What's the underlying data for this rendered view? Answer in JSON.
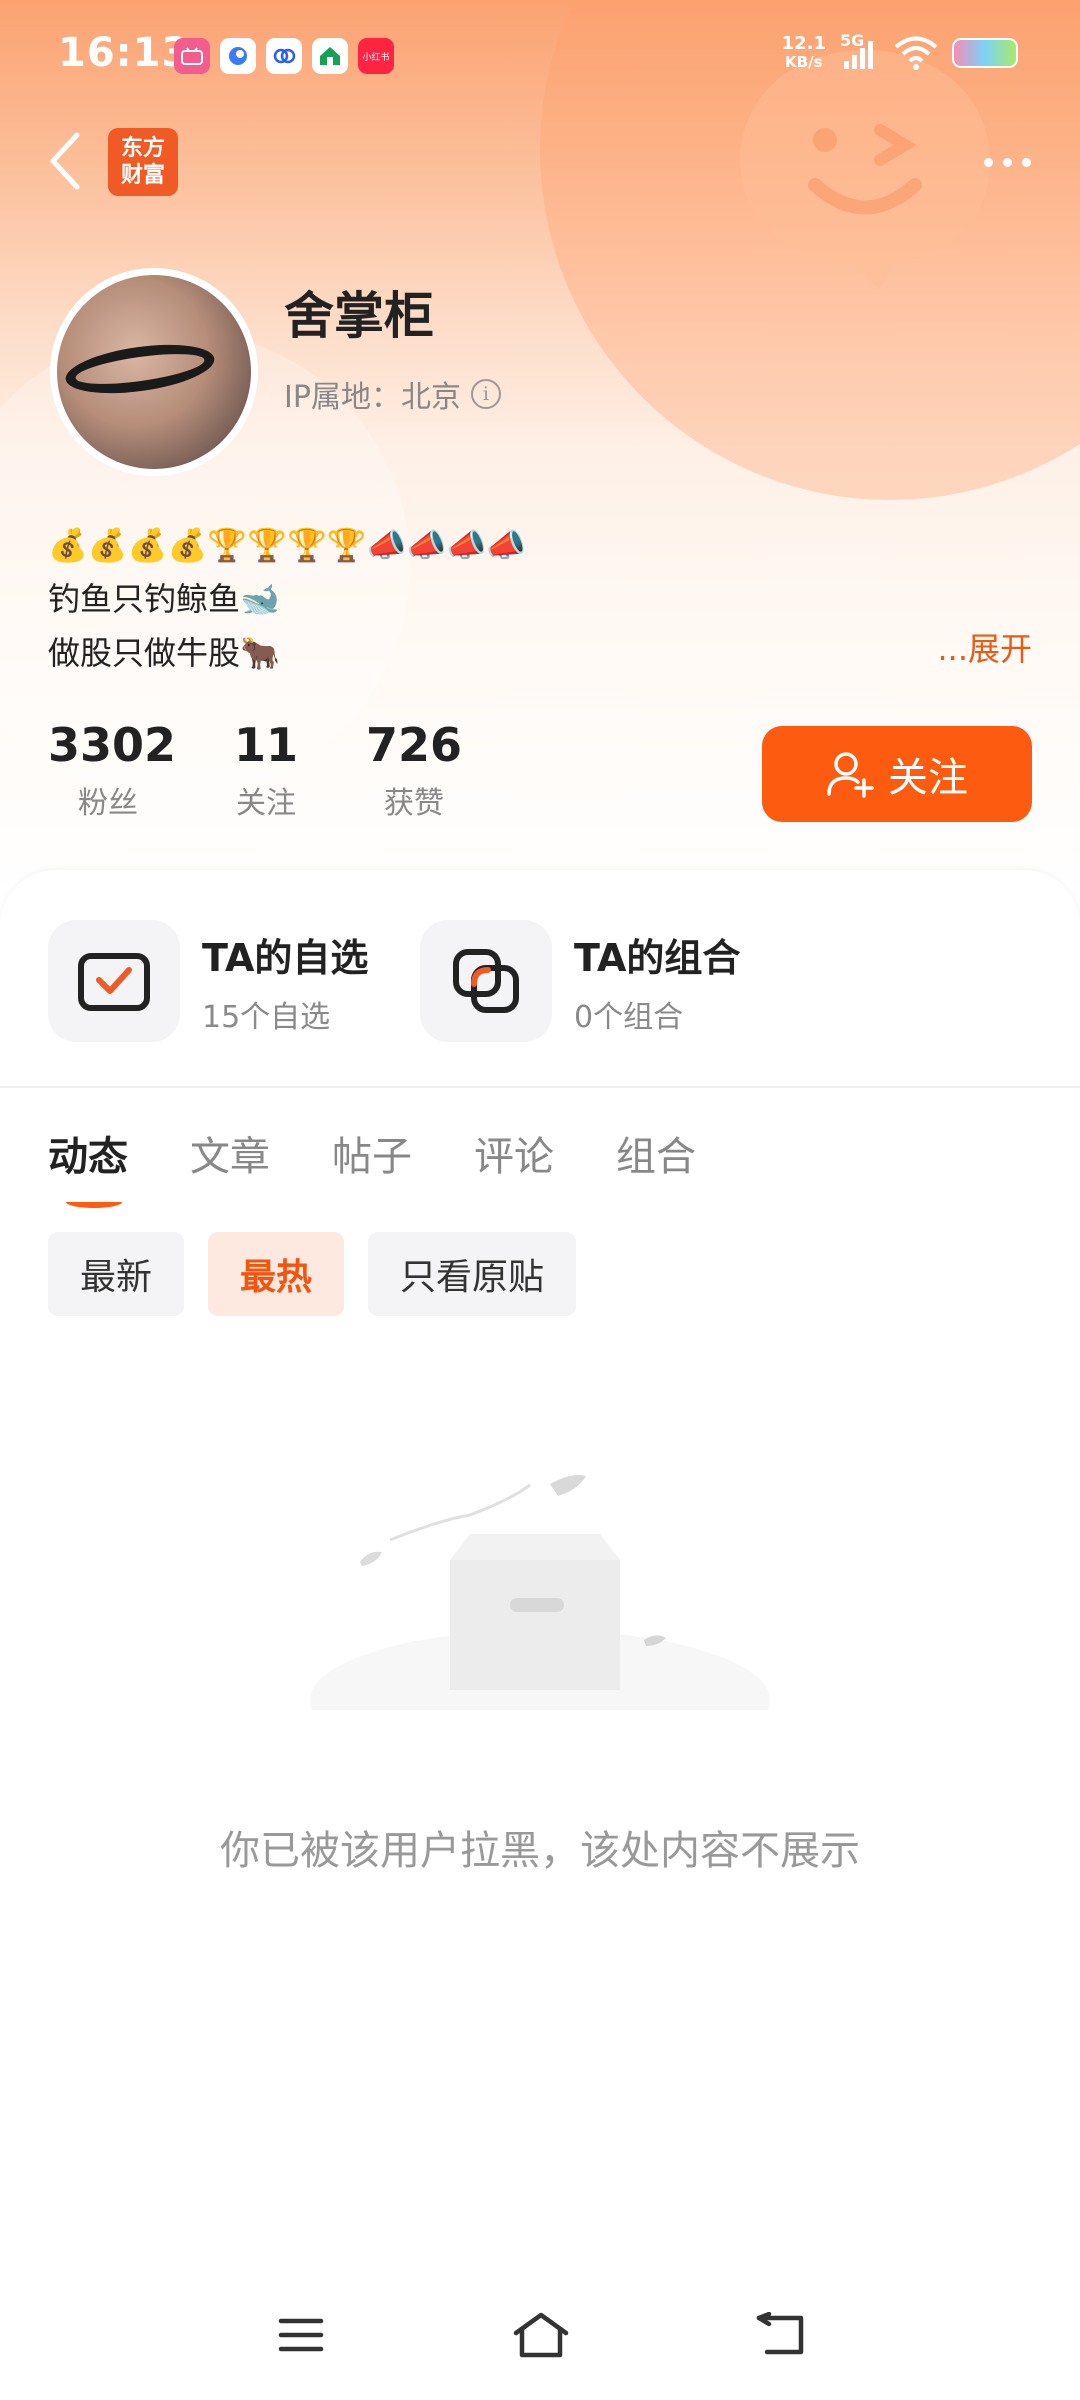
{
  "status_bar": {
    "time": "16:13",
    "net_speed_value": "12.1",
    "net_speed_unit": "KB/s",
    "network_type": "5G",
    "app_icons": [
      "bilibili",
      "app-blue",
      "app-circle",
      "app-house",
      "小红书"
    ]
  },
  "nav": {
    "logo_line1": "东方",
    "logo_line2": "财富"
  },
  "profile": {
    "username": "舍掌柜",
    "ip_location": "IP属地：北京",
    "bio_line1": "💰💰💰💰🏆🏆🏆🏆📣📣📣📣",
    "bio_line2": "钓鱼只钓鲸鱼🐋",
    "bio_line3": "做股只做牛股🐂",
    "expand_label": "...展开"
  },
  "stats": [
    {
      "value": "3302",
      "label": "粉丝"
    },
    {
      "value": "11",
      "label": "关注"
    },
    {
      "value": "726",
      "label": "获赞"
    }
  ],
  "follow_button_label": "关注",
  "portfolio": [
    {
      "title": "TA的自选",
      "subtitle": "15个自选"
    },
    {
      "title": "TA的组合",
      "subtitle": "0个组合"
    }
  ],
  "tabs": [
    "动态",
    "文章",
    "帖子",
    "评论",
    "组合"
  ],
  "filters": [
    "最新",
    "最热",
    "只看原贴"
  ],
  "empty_message": "你已被该用户拉黑，该处内容不展示",
  "colors": {
    "accent": "#fd5b0f",
    "accent_text": "#e65c17",
    "chip_active_bg": "#fde9df"
  }
}
